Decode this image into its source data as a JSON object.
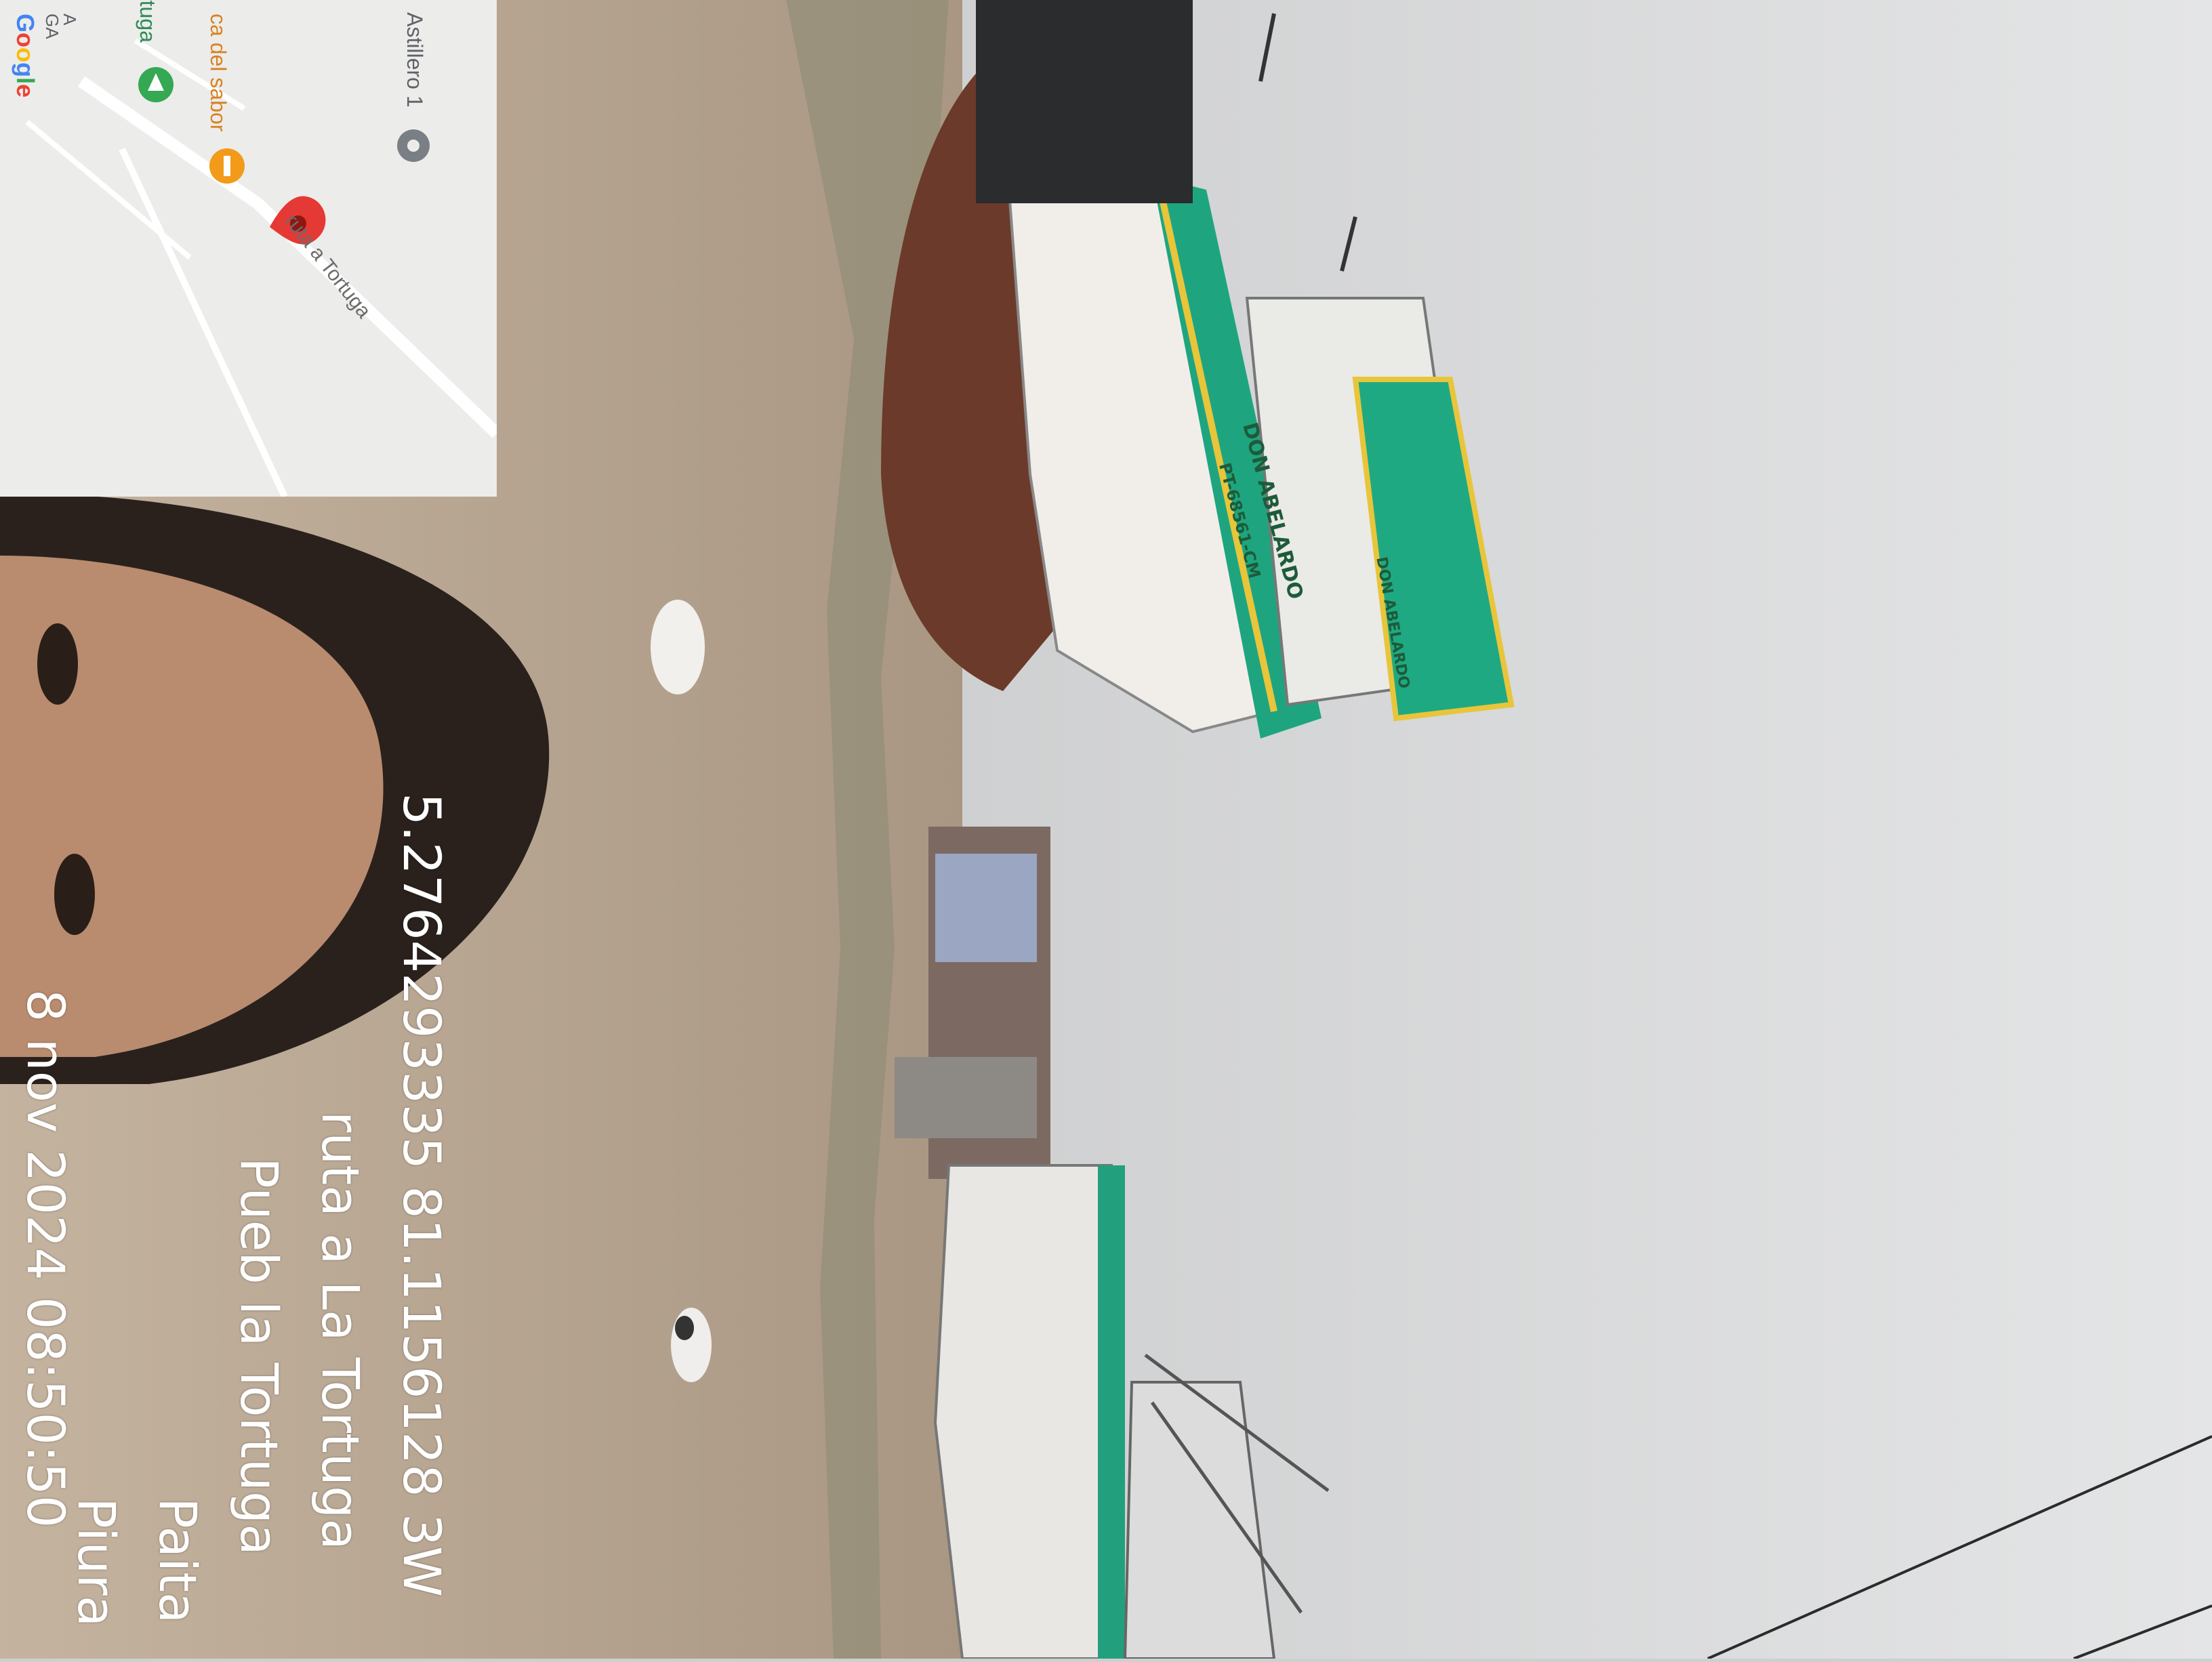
{
  "photo_stamp": {
    "coordinates": "5.2764293335 81.1156128 3W",
    "street": "ruta a La Tortuga",
    "locality": "Pueb la Tortuga",
    "city": "Paita",
    "region": "Piura",
    "datetime": "8 nov 2024 08:50:50"
  },
  "map_inset": {
    "labels": [
      "Astillero 1",
      "ca del sabor",
      "rtuga",
      "ruta a Tortuga"
    ],
    "partial_labels": [
      "A",
      "GA"
    ],
    "google_logo": {
      "letters": [
        "G",
        "o",
        "o",
        "g",
        "l",
        "e"
      ],
      "colors": [
        "#4285F4",
        "#EA4335",
        "#FBBC05",
        "#4285F4",
        "#34A853",
        "#EA4335"
      ]
    }
  },
  "boat": {
    "hull_name": "DON ABELARDO",
    "registration": "PT-68561-CM",
    "cabin_name": "DON ABELARDO"
  },
  "colors": {
    "sky": "#d7d8d9",
    "sand": "#b9a792",
    "boat_green": "#1ea57f",
    "boat_yellow": "#e8c53a",
    "hull_brown": "#6b3a2a",
    "map_pin_red": "#e53935",
    "map_pin_orange": "#f29b18",
    "map_pin_green": "#34a853",
    "map_pin_gray": "#7a7f86"
  }
}
